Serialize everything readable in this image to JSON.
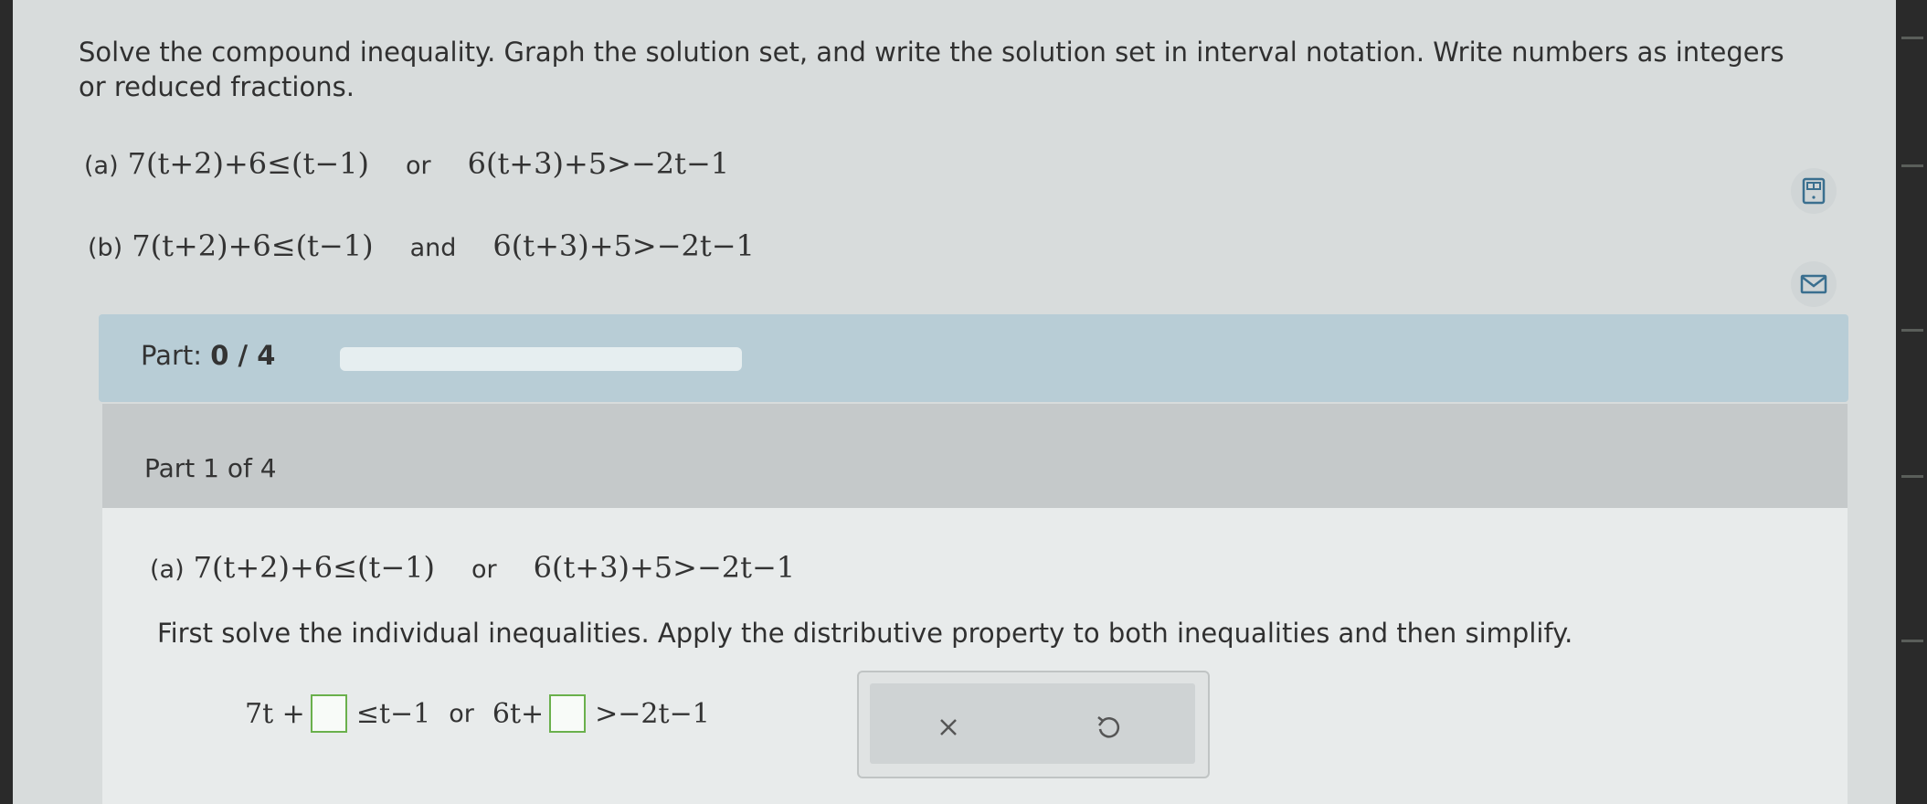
{
  "instructions": "Solve the compound inequality. Graph the solution set, and write the solution set in interval notation. Write numbers as integers or reduced fractions.",
  "problems": {
    "a": {
      "label": "(a)",
      "left": "7(t+2)+6≤(t−1)",
      "conjunction": "or",
      "right": "6(t+3)+5>−2t−1"
    },
    "b": {
      "label": "(b)",
      "left": "7(t+2)+6≤(t−1)",
      "conjunction": "and",
      "right": "6(t+3)+5>−2t−1"
    }
  },
  "progress": {
    "label": "Part:",
    "value": "0 / 4",
    "fraction": 0
  },
  "part": {
    "title": "Part 1 of 4",
    "problem": {
      "label": "(a)",
      "left": "7(t+2)+6≤(t−1)",
      "conjunction": "or",
      "right": "6(t+3)+5>−2t−1"
    },
    "step_text": "First solve the individual inequalities. Apply the distributive property to both inequalities and then simplify.",
    "answer": {
      "left_prefix": "7t +",
      "left_suffix": "≤t−1",
      "conjunction": "or",
      "right_prefix": "6t+",
      "right_suffix": ">−2t−1",
      "box1_value": "",
      "box2_value": ""
    }
  },
  "tools": {
    "clear": "×",
    "undo": "undo-icon"
  },
  "icons": {
    "side_1": "calculator-icon",
    "side_2": "mail-icon"
  },
  "colors": {
    "progress_bar": "#b8cdd6",
    "part_header": "#c5c9ca",
    "answer_box_border": "#6ab04c"
  }
}
